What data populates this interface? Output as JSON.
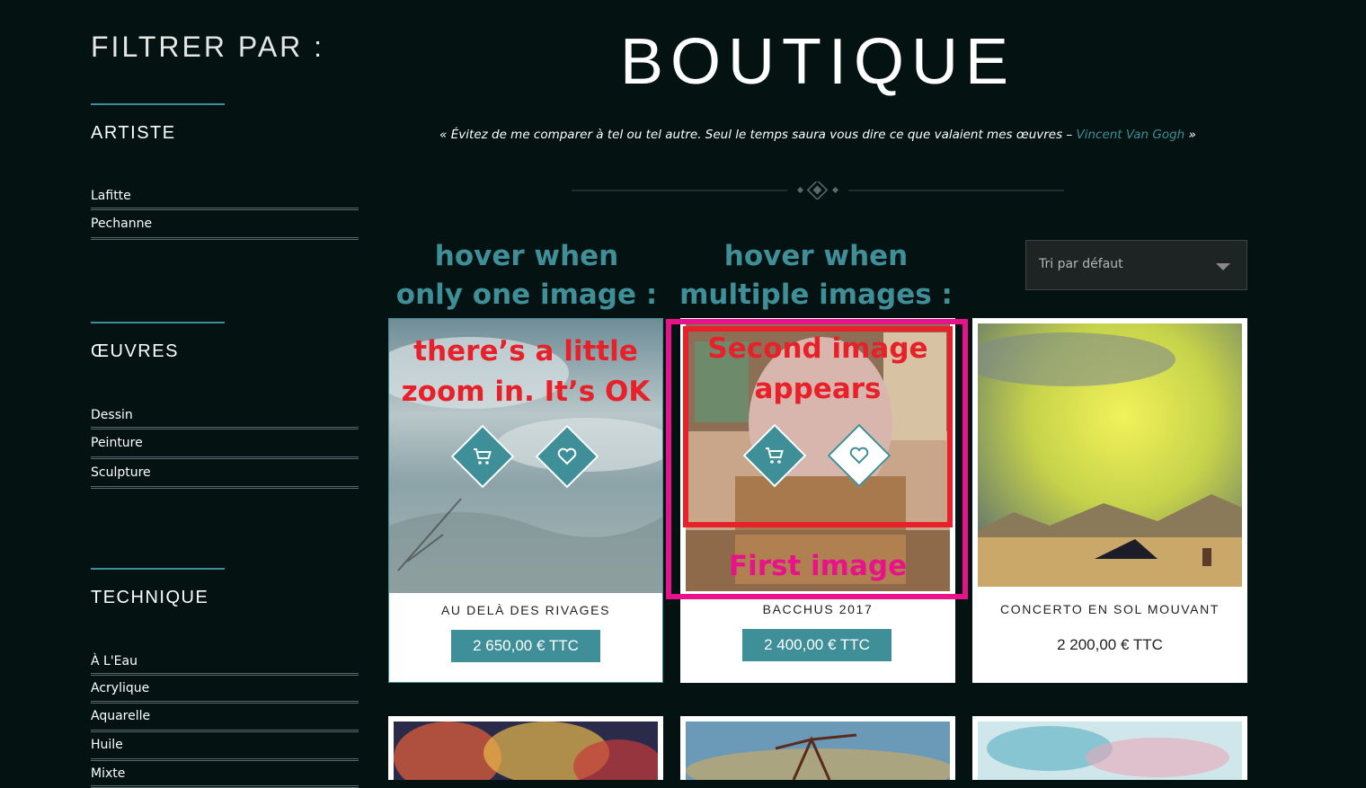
{
  "sidebar": {
    "title": "FILTRER PAR :",
    "sections": [
      {
        "heading": "ARTISTE",
        "items": [
          "Lafitte",
          "Pechanne"
        ]
      },
      {
        "heading": "ŒUVRES",
        "items": [
          "Dessin",
          "Peinture",
          "Sculpture"
        ]
      },
      {
        "heading": "TECHNIQUE",
        "items": [
          "À L'Eau",
          "Acrylique",
          "Aquarelle",
          "Huile",
          "Mixte"
        ]
      }
    ]
  },
  "header": {
    "title": "BOUTIQUE",
    "quote_open": "« ",
    "quote_text": "Évitez de me comparer à tel ou tel autre. Seul le temps saura vous dire ce que valaient mes œuvres – ",
    "quote_author": "Vincent Van Gogh",
    "quote_close": " »"
  },
  "sort": {
    "selected": "Tri par défaut"
  },
  "annotations": {
    "single_hover": [
      "hover when",
      "only one image :"
    ],
    "multi_hover": [
      "hover when",
      "multiple images :"
    ],
    "zoom_note": [
      "there’s a little",
      "zoom in. It’s OK"
    ],
    "second_image": [
      "Second image",
      "appears"
    ],
    "first_image": "First image"
  },
  "products": [
    {
      "title": "AU DELÀ DES RIVAGES",
      "price": "2 650,00 € TTC"
    },
    {
      "title": "BACCHUS 2017",
      "price": "2 400,00 € TTC"
    },
    {
      "title": "CONCERTO EN SOL MOUVANT",
      "price": "2 200,00 € TTC"
    }
  ],
  "icons": {
    "cart": "cart-icon",
    "wishlist": "heart-icon",
    "sort_arrow": "chevron-down-icon",
    "divider": "diamond-ornament-icon"
  },
  "colors": {
    "background": "#041212",
    "accent": "#3e8f98",
    "annotation_red": "#e8202a",
    "annotation_pink": "#e8138a"
  }
}
